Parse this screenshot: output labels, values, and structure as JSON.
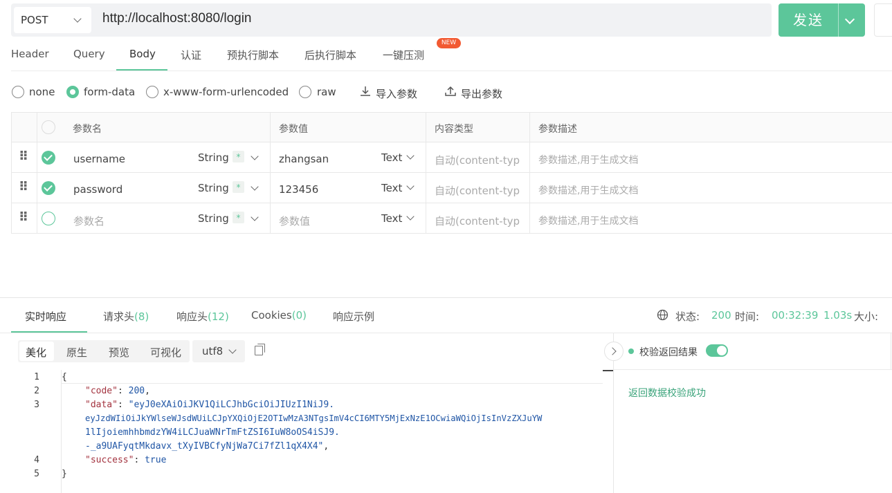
{
  "request": {
    "method": "POST",
    "url": "http://localhost:8080/login",
    "send_label": "发送"
  },
  "request_tabs": [
    {
      "label": "Header"
    },
    {
      "label": "Query"
    },
    {
      "label": "Body"
    },
    {
      "label": "认证"
    },
    {
      "label": "预执行脚本"
    },
    {
      "label": "后执行脚本"
    },
    {
      "label": "一键压测"
    }
  ],
  "active_request_tab": "Body",
  "new_badge": "NEW",
  "body_types": [
    {
      "label": "none",
      "selected": false
    },
    {
      "label": "form-data",
      "selected": true
    },
    {
      "label": "x-www-form-urlencoded",
      "selected": false
    },
    {
      "label": "raw",
      "selected": false
    }
  ],
  "body_tools": {
    "import_label": "导入参数",
    "export_label": "导出参数"
  },
  "params_table": {
    "headers": [
      "参数名",
      "参数值",
      "内容类型",
      "参数描述"
    ],
    "rows": [
      {
        "checked": true,
        "name": "username",
        "name_is_placeholder": false,
        "type": "String",
        "value": "zhangsan",
        "value_is_placeholder": false,
        "value_type": "Text",
        "content_type": "自动(content-typ",
        "description": "参数描述,用于生成文档"
      },
      {
        "checked": true,
        "name": "password",
        "name_is_placeholder": false,
        "type": "String",
        "value": "123456",
        "value_is_placeholder": false,
        "value_type": "Text",
        "content_type": "自动(content-typ",
        "description": "参数描述,用于生成文档"
      },
      {
        "checked": false,
        "name": "参数名",
        "name_is_placeholder": true,
        "type": "String",
        "value": "参数值",
        "value_is_placeholder": true,
        "value_type": "Text",
        "content_type": "自动(content-typ",
        "description": "参数描述,用于生成文档"
      }
    ],
    "required_mark": "*"
  },
  "response_tabs": [
    {
      "label": "实时响应",
      "count": ""
    },
    {
      "label": "请求头",
      "count": "(8)"
    },
    {
      "label": "响应头",
      "count": "(12)"
    },
    {
      "label": "Cookies",
      "count": "(0)"
    },
    {
      "label": "响应示例",
      "count": ""
    }
  ],
  "status_bar": {
    "status_label": "状态:",
    "status_value": "200",
    "time_label": "时间:",
    "time_value": "00:32:39",
    "duration": "1.03s",
    "size_label": "大小:"
  },
  "format_tabs": [
    "美化",
    "原生",
    "预览",
    "可视化"
  ],
  "encoding": "utf8",
  "code_lines": [
    {
      "n": "1",
      "text": "{"
    },
    {
      "n": "2",
      "key": "\"code\"",
      "sep": ": ",
      "val": "200",
      "end": ","
    },
    {
      "n": "3",
      "key": "\"data\"",
      "sep": ": ",
      "val": "\"eyJ0eXAiOiJKV1QiLCJhbGciOiJIUzI1NiJ9."
    },
    {
      "n": "",
      "val": "eyJzdWIiOiJkYWlseWJsdWUiLCJpYXQiOjE2OTIwMzA3NTgsImV4cCI6MTY5MjExNzE1OCwiaWQiOjIsInVzZXJuYW"
    },
    {
      "n": "",
      "val": "1lIjoiemhhbmdzYW4iLCJuaWNrTmFtZSI6IuW8oOS4iSJ9."
    },
    {
      "n": "",
      "val": "-_a9UAFyqtMkdavx_tXyIVBCfyNjWa7Ci7fZl1qX4X4\"",
      "end": ","
    },
    {
      "n": "4",
      "key": "\"success\"",
      "sep": ": ",
      "val": "true"
    },
    {
      "n": "5",
      "text": "}"
    }
  ],
  "validation": {
    "toggle_label": "校验返回结果",
    "toggle_on": true,
    "result_text": "返回数据校验成功"
  },
  "colors": {
    "accent": "#5cc69a",
    "badge": "#f25a32"
  }
}
